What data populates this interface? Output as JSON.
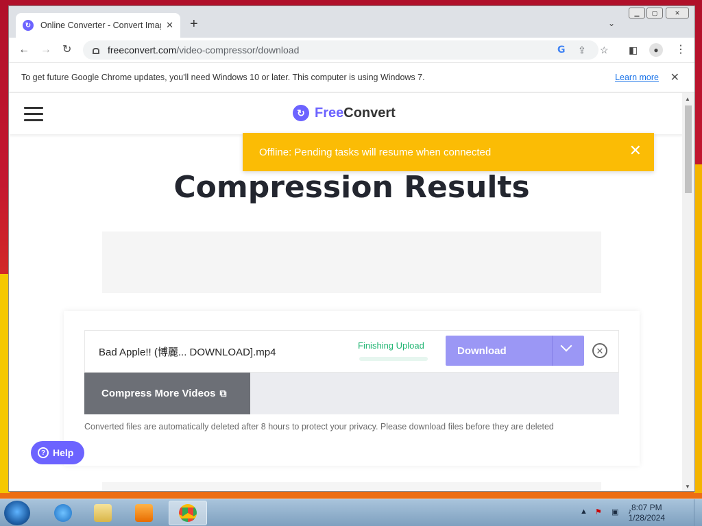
{
  "browser": {
    "tab_title": "Online Converter - Convert Imag",
    "address_domain": "freeconvert.com",
    "address_path": "/video-compressor/download"
  },
  "infobar": {
    "message": "To get future Google Chrome updates, you'll need Windows 10 or later. This computer is using Windows 7.",
    "learn_more": "Learn more"
  },
  "site": {
    "logo_part1": "Free",
    "logo_part2": "Convert"
  },
  "toast": {
    "message": "Offline: Pending tasks will resume when connected"
  },
  "main": {
    "title": "Compression Results",
    "file_name": "Bad Apple!! (博麗... DOWNLOAD].mp4",
    "status": "Finishing Upload",
    "download_label": "Download",
    "compress_more_label": "Compress More Videos",
    "note": "Converted files are automatically deleted after 8 hours to protect your privacy. Please download files before they are deleted"
  },
  "help_label": "Help",
  "taskbar": {
    "time": "8:07 PM",
    "date": "1/28/2024"
  },
  "colors": {
    "brand": "#6c63ff",
    "toast": "#fbbc05",
    "status_green": "#22b573"
  }
}
